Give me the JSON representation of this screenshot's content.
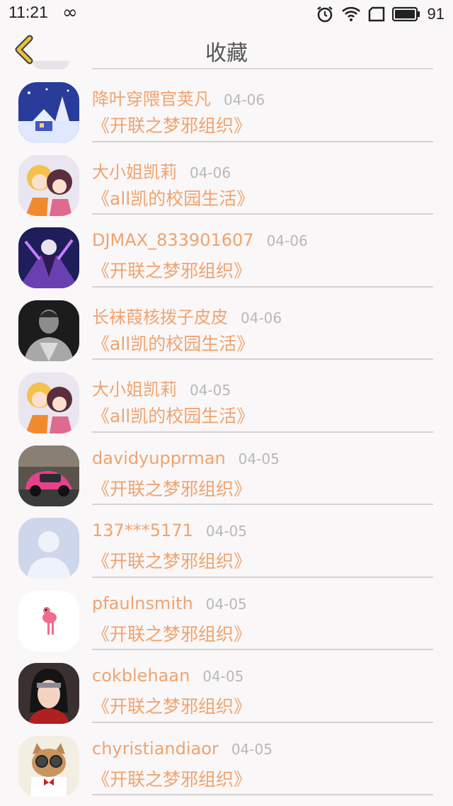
{
  "status_bar": {
    "time": "11:21",
    "battery": "91"
  },
  "header": {
    "title": "收藏"
  },
  "favorites": [
    {
      "name": "降叶穿隈官荚凡",
      "date": "04-06",
      "book": "《开联之梦邪组织》",
      "avatar": "snow-house-avatar"
    },
    {
      "name": "大小姐凯莉",
      "date": "04-06",
      "book": "《all凯的校园生活》",
      "avatar": "anime-duo-avatar"
    },
    {
      "name": "DJMAX_833901607",
      "date": "04-06",
      "book": "《开联之梦邪组织》",
      "avatar": "dark-fantasy-avatar"
    },
    {
      "name": "长袜葭核拨子皮皮",
      "date": "04-06",
      "book": "《all凯的校园生活》",
      "avatar": "man-portrait-avatar"
    },
    {
      "name": "大小姐凯莉",
      "date": "04-05",
      "book": "《all凯的校园生活》",
      "avatar": "anime-duo-avatar"
    },
    {
      "name": "davidyupprman",
      "date": "04-05",
      "book": "《开联之梦邪组织》",
      "avatar": "pink-car-avatar"
    },
    {
      "name": "137***5171",
      "date": "04-05",
      "book": "《开联之梦邪组织》",
      "avatar": "default-user-avatar"
    },
    {
      "name": "pfaulnsmith",
      "date": "04-05",
      "book": "《开联之梦邪组织》",
      "avatar": "flamingo-avatar"
    },
    {
      "name": "cokblehaan",
      "date": "04-05",
      "book": "《开联之梦邪组织》",
      "avatar": "ninja-avatar"
    },
    {
      "name": "chyristiandiaor",
      "date": "04-05",
      "book": "《开联之梦邪组织》",
      "avatar": "cat-glasses-avatar"
    }
  ],
  "colors": {
    "accent": "#f0a36e",
    "date": "#b8b8b8",
    "back_arrow": "#e8c13a"
  }
}
